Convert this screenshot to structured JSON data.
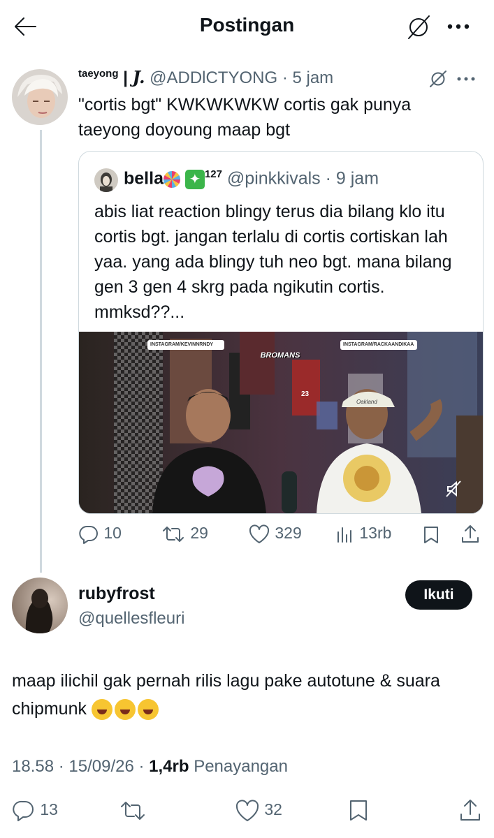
{
  "header": {
    "title": "Postingan"
  },
  "parent": {
    "display_name": "taeyong",
    "separator": "|",
    "name_mark": "J.",
    "handle": "@ADDlCTYONG",
    "time": "5 jam",
    "text": "\"cortis bgt\" KWKWKWKW cortis gak punya taeyong doyoung maap bgt"
  },
  "quote": {
    "display_name": "bella",
    "badge_emoji": "✦",
    "badge_count": "127",
    "handle": "@pinkkivals",
    "time": "9 jam",
    "text": "abis liat reaction blingy terus dia bilang klo itu cortis bgt. jangan terlalu di cortis cortiskan lah yaa. yang ada blingy tuh neo bgt. mana bilang gen 3 gen 4 skrg pada ngikutin cortis. mmksd??...",
    "video": {
      "tag_left": "INSTAGRAM/KEVINNRNDY",
      "tag_right": "INSTAGRAM/RACKAANDIKAA",
      "logo": "BROMANS",
      "cap_text": "Oakland",
      "jersey_text": "23"
    }
  },
  "parent_actions": {
    "replies": "10",
    "reposts": "29",
    "likes": "329",
    "views": "13rb"
  },
  "reply": {
    "display_name": "rubyfrost",
    "handle": "@quellesfleuri",
    "follow_label": "Ikuti",
    "text": "maap ilichil gak pernah rilis lagu pake autotune & suara chipmunk",
    "time": "18.58",
    "date": "15/09/26",
    "views_count": "1,4rb",
    "views_label": "Penayangan"
  },
  "reply_actions": {
    "replies": "13",
    "likes": "32"
  },
  "colors": {
    "text": "#0f1419",
    "secondary": "#536471",
    "border": "#cfd9de",
    "follow_bg": "#0f1419"
  }
}
